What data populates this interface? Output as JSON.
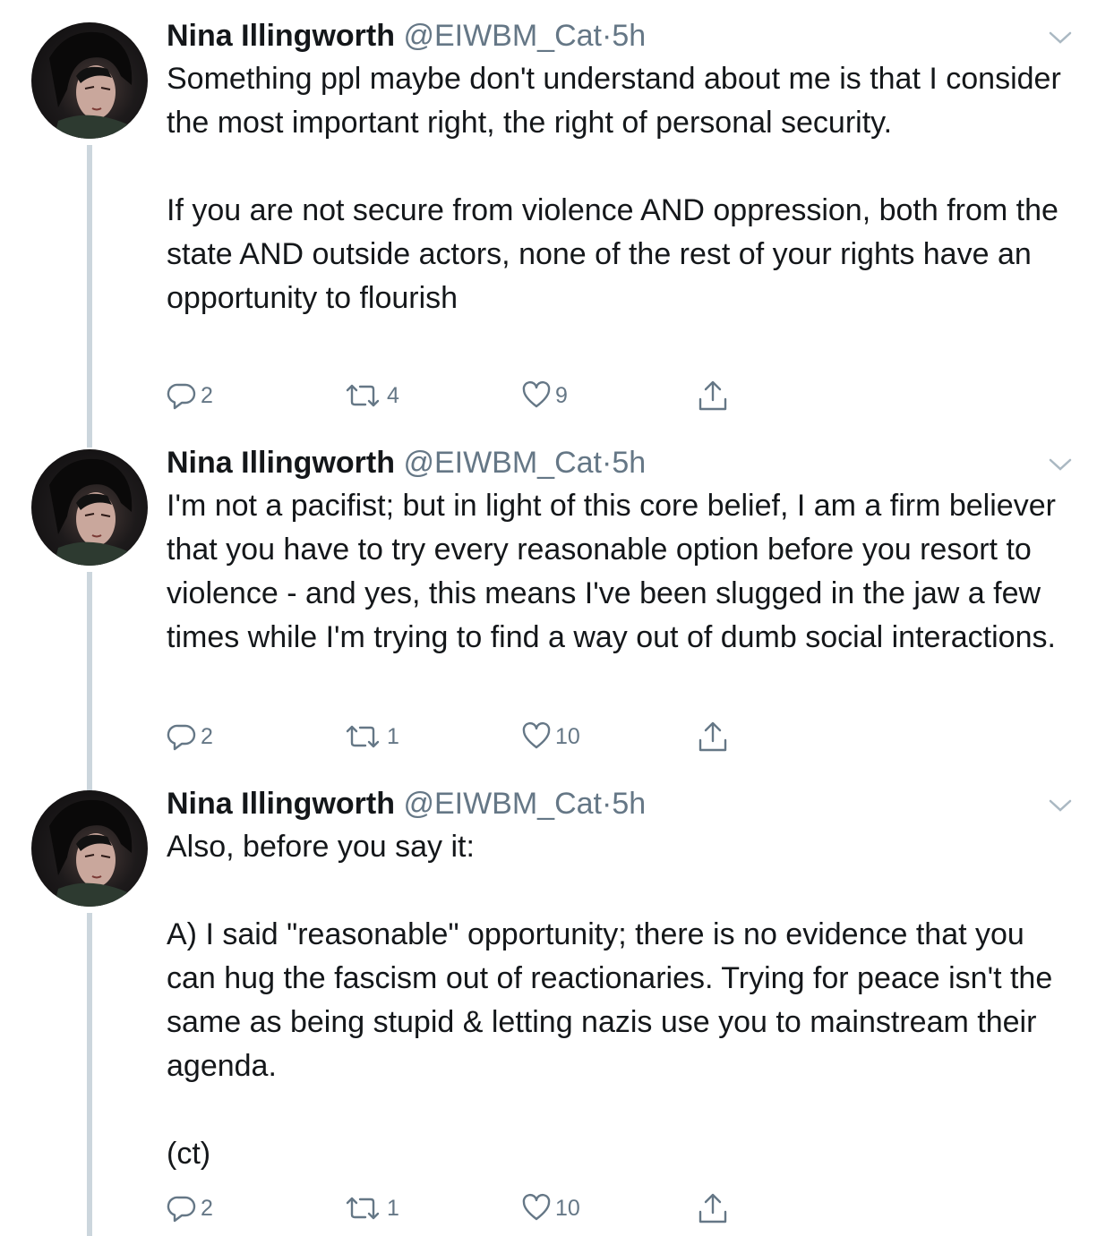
{
  "tweets": [
    {
      "name": "Nina Illingworth",
      "handle": "@EIWBM_Cat",
      "separator": "·",
      "time": "5h",
      "text": "Something ppl maybe don't understand about me is that I consider the most important right, the right of personal security.\n\nIf you are not secure from violence AND oppression, both from the state AND outside actors, none of the rest of your rights have an opportunity to flourish",
      "replies": "2",
      "retweets": "4",
      "likes": "9"
    },
    {
      "name": "Nina Illingworth",
      "handle": "@EIWBM_Cat",
      "separator": "·",
      "time": "5h",
      "text": "I'm not a pacifist; but in light of this core belief, I am a firm believer that you have to try every reasonable option before you resort to violence - and yes, this means I've been slugged in the jaw a few times while I'm trying to find a way out of dumb social interactions.",
      "replies": "2",
      "retweets": "1",
      "likes": "10"
    },
    {
      "name": "Nina Illingworth",
      "handle": "@EIWBM_Cat",
      "separator": "·",
      "time": "5h",
      "text": "Also, before you say it:\n\nA) I said \"reasonable\" opportunity; there is no evidence that you can hug the fascism out of reactionaries. Trying for peace isn't the same as being stupid & letting nazis use you to mainstream their agenda.\n\n(ct)",
      "replies": "2",
      "retweets": "1",
      "likes": "10"
    }
  ],
  "icons": {
    "reply": "reply-icon",
    "retweet": "retweet-icon",
    "like": "heart-icon",
    "share": "share-icon",
    "menu": "chevron-down-icon"
  },
  "colors": {
    "text": "#14171a",
    "muted": "#657786",
    "thread_line": "#ccd6dd"
  }
}
